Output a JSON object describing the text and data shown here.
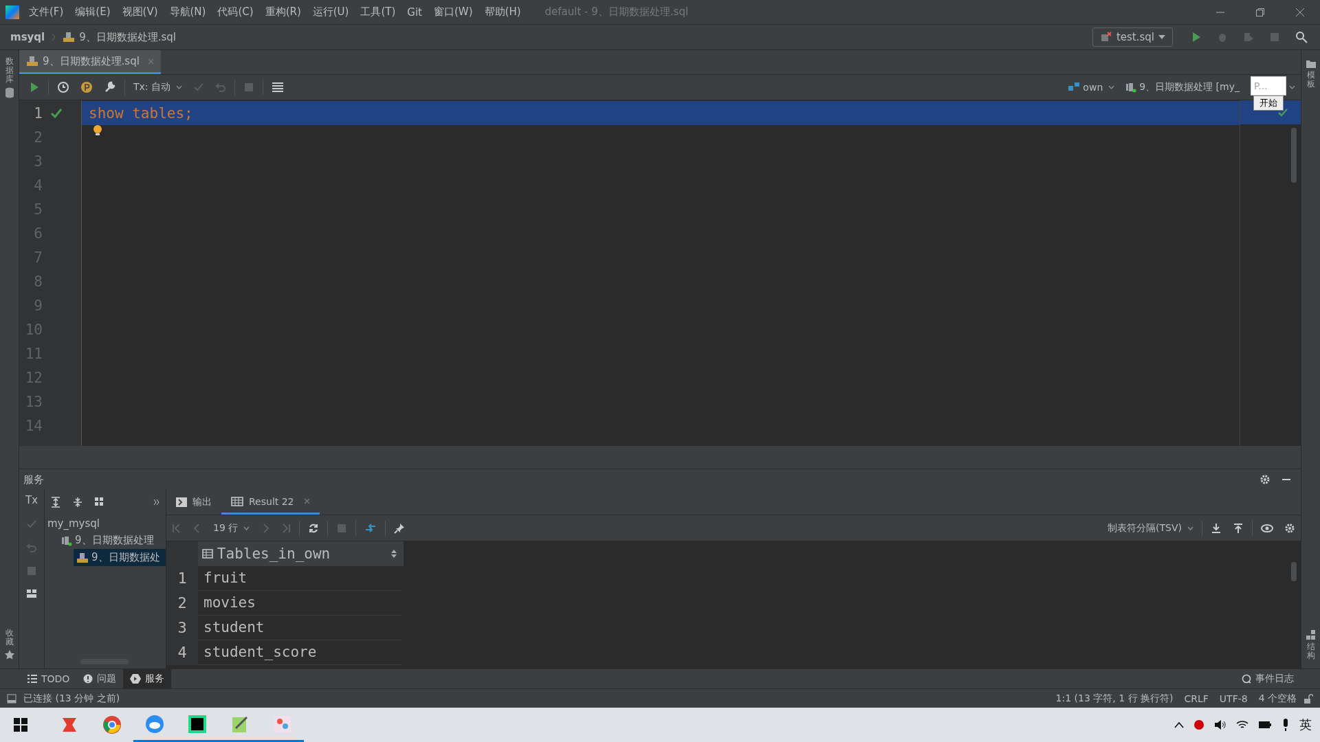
{
  "window": {
    "title": "default - 9、日期数据处理.sql"
  },
  "menu": [
    "文件(F)",
    "编辑(E)",
    "视图(V)",
    "导航(N)",
    "代码(C)",
    "重构(R)",
    "运行(U)",
    "工具(T)",
    "Git",
    "窗口(W)",
    "帮助(H)"
  ],
  "breadcrumb": [
    "msyql",
    "9、日期数据处理.sql"
  ],
  "run_config": {
    "label": "test.sql"
  },
  "left_stripe": {
    "top": "数据库",
    "bottom": "收藏"
  },
  "right_stripe": {
    "top": "模板",
    "bottom": "结构"
  },
  "editor_tabs": [
    {
      "label": "9、日期数据处理.sql",
      "selected": true
    }
  ],
  "editor_toolbar": {
    "tx": "Tx: 自动",
    "schema": "own",
    "session": "9、日期数据处理 [my_"
  },
  "popup": {
    "field": "P...",
    "button": "开始"
  },
  "editor": {
    "lines": [
      {
        "number": "1",
        "code": "show tables;",
        "current": true,
        "executed": true,
        "hint": false
      },
      {
        "number": "2",
        "current": false,
        "executed": false,
        "hint": true
      },
      {
        "number": "3",
        "current": false,
        "executed": false,
        "hint": false
      },
      {
        "number": "4",
        "current": false,
        "executed": false,
        "hint": false
      },
      {
        "number": "5",
        "current": false,
        "executed": false,
        "hint": false
      },
      {
        "number": "6",
        "current": false,
        "executed": false,
        "hint": false
      },
      {
        "number": "7",
        "current": false,
        "executed": false,
        "hint": false
      },
      {
        "number": "8",
        "current": false,
        "executed": false,
        "hint": false
      },
      {
        "number": "9",
        "current": false,
        "executed": false,
        "hint": false
      },
      {
        "number": "10",
        "current": false,
        "executed": false,
        "hint": false
      },
      {
        "number": "11",
        "current": false,
        "executed": false,
        "hint": false
      },
      {
        "number": "12",
        "current": false,
        "executed": false,
        "hint": false
      },
      {
        "number": "13",
        "current": false,
        "executed": false,
        "hint": false
      },
      {
        "number": "14",
        "current": false,
        "executed": false,
        "hint": false
      }
    ]
  },
  "services": {
    "title": "服务",
    "tx": "Tx",
    "tree": [
      {
        "label": "my_mysql",
        "selected": false,
        "children": [
          {
            "label": "9、日期数据处理",
            "kind": "session",
            "selected": false,
            "children": [
              {
                "label": "9、日期数据处",
                "kind": "console",
                "selected": true
              }
            ]
          }
        ]
      }
    ],
    "tabs": [
      {
        "label": "输出",
        "kind": "output",
        "selected": false
      },
      {
        "label": "Result 22",
        "kind": "result",
        "selected": true
      }
    ],
    "rows_label": "19 行",
    "export_format": "制表符分隔(TSV)",
    "table": {
      "columns": [
        "Tables_in_own"
      ],
      "rows": [
        {
          "number": "1",
          "cells": [
            "fruit"
          ]
        },
        {
          "number": "2",
          "cells": [
            "movies"
          ]
        },
        {
          "number": "3",
          "cells": [
            "student"
          ]
        },
        {
          "number": "4",
          "cells": [
            "student_score"
          ]
        }
      ]
    }
  },
  "tool_tabs": [
    {
      "label": "TODO",
      "kind": "list",
      "selected": false
    },
    {
      "label": "问题",
      "kind": "problems",
      "selected": false
    },
    {
      "label": "服务",
      "kind": "services",
      "selected": true
    }
  ],
  "status_bar": {
    "message": "已连接 (13 分钟 之前)",
    "event_log": "事件日志",
    "position": "1:1 (13 字符, 1 行 换行符)",
    "line_separator": "CRLF",
    "encoding": "UTF-8",
    "indent": "4 个空格"
  },
  "taskbar": {
    "input_method": "英"
  }
}
